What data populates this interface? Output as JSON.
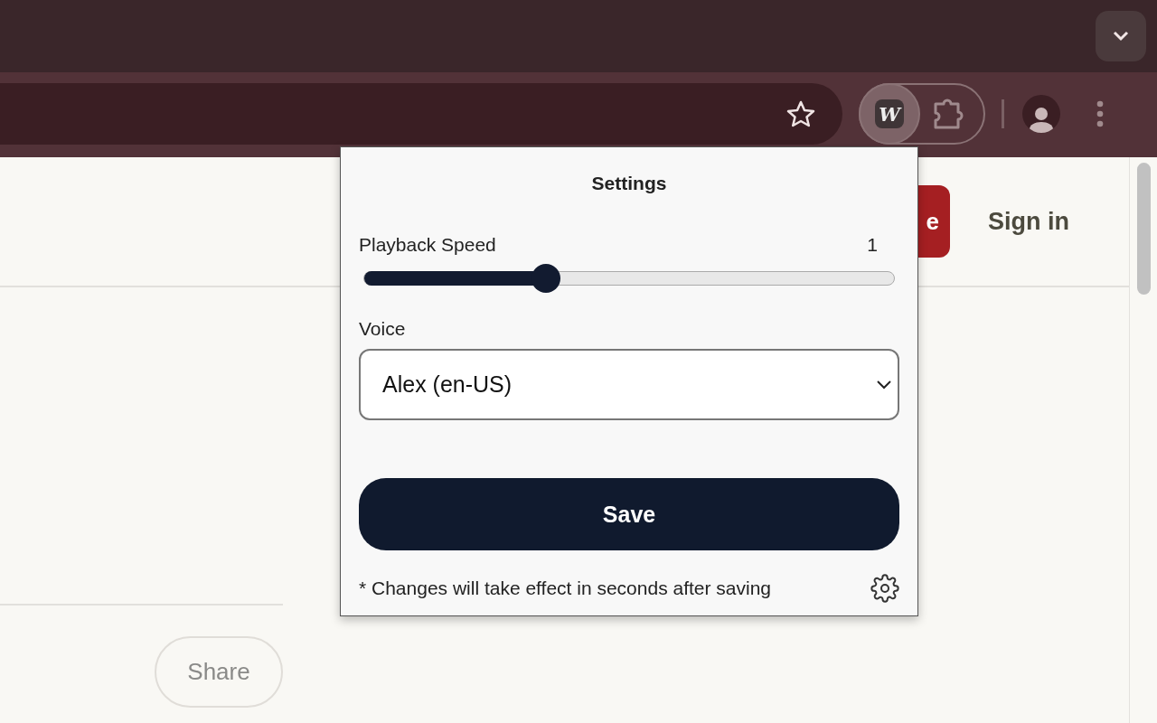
{
  "toolbar": {
    "extension_logo": "W",
    "extension_active": true
  },
  "page": {
    "header_button": "e",
    "sign_in": "Sign in",
    "share": "Share"
  },
  "popup": {
    "title": "Settings",
    "speed": {
      "label": "Playback Speed",
      "value": "1",
      "level": 0.343
    },
    "voice": {
      "label": "Voice",
      "value": "Alex (en-US)"
    },
    "save": "Save",
    "note": "* Changes will take effect in seconds after saving"
  }
}
